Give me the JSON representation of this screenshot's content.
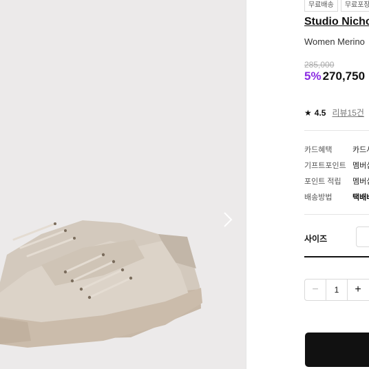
{
  "badges": [
    "무료배송",
    "무료포장"
  ],
  "product": {
    "brand": "Studio Nicho",
    "name": "Women Merino",
    "original_price": "285,000",
    "discount": "5%",
    "price": "270,750"
  },
  "rating": {
    "score": "4.5",
    "reviews_label": "리뷰15건"
  },
  "info_rows": [
    {
      "label": "카드혜택",
      "value": "카드사",
      "bold": false
    },
    {
      "label": "기프트포인트",
      "value": "멤버십",
      "bold": false
    },
    {
      "label": "포인트 적립",
      "value": "멤버십",
      "bold": false
    },
    {
      "label": "배송방법",
      "value": "택배배",
      "bold": true
    }
  ],
  "size_label": "사이즈",
  "quantity": "1",
  "icons": {
    "star": "star-icon",
    "next": "chevron-right-icon",
    "minus": "minus-icon",
    "plus": "plus-icon"
  },
  "colors": {
    "discount": "#8a2be2",
    "buy_button": "#111111",
    "gallery_bg": "#eceaea"
  }
}
